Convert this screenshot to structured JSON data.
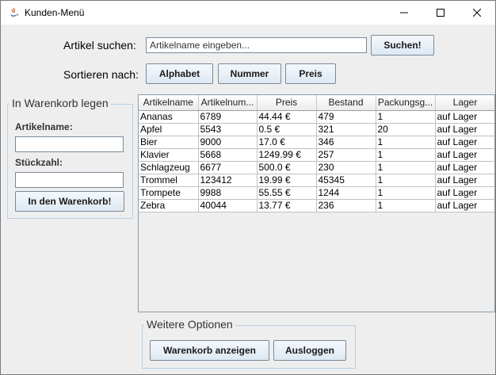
{
  "window": {
    "title": "Kunden-Menü",
    "app_icon": "java-icon",
    "controls": [
      "minimize-icon",
      "maximize-icon",
      "close-icon"
    ]
  },
  "search": {
    "label": "Artikel suchen:",
    "placeholder": "Artikelname eingeben...",
    "button": "Suchen!"
  },
  "sort": {
    "label": "Sortieren nach:",
    "buttons": [
      "Alphabet",
      "Nummer",
      "Preis"
    ]
  },
  "cart_panel": {
    "title": "In Warenkorb legen",
    "name_label": "Artikelname:",
    "name_value": "",
    "qty_label": "Stückzahl:",
    "qty_value": "",
    "button": "In den Warenkorb!"
  },
  "table": {
    "headers": [
      "Artikelname",
      "Artikelnum...",
      "Preis",
      "Bestand",
      "Packungsg...",
      "Lager"
    ],
    "rows": [
      [
        "Ananas",
        "6789",
        "44.44 €",
        "479",
        "1",
        "auf Lager"
      ],
      [
        "Apfel",
        "5543",
        "0.5 €",
        "321",
        "20",
        "auf Lager"
      ],
      [
        "Bier",
        "9000",
        "17.0 €",
        "346",
        "1",
        "auf Lager"
      ],
      [
        "Klavier",
        "5668",
        "1249.99 €",
        "257",
        "1",
        "auf Lager"
      ],
      [
        "Schlagzeug",
        "6677",
        "500.0 €",
        "230",
        "1",
        "auf Lager"
      ],
      [
        "Trommel",
        "123412",
        "19.99 €",
        "45345",
        "1",
        "auf Lager"
      ],
      [
        "Trompete",
        "9988",
        "55.55 €",
        "1244",
        "1",
        "auf Lager"
      ],
      [
        "Zebra",
        "40044",
        "13.77 €",
        "236",
        "1",
        "auf Lager"
      ]
    ]
  },
  "options": {
    "title": "Weitere Optionen",
    "show_cart": "Warenkorb anzeigen",
    "logout": "Ausloggen"
  }
}
